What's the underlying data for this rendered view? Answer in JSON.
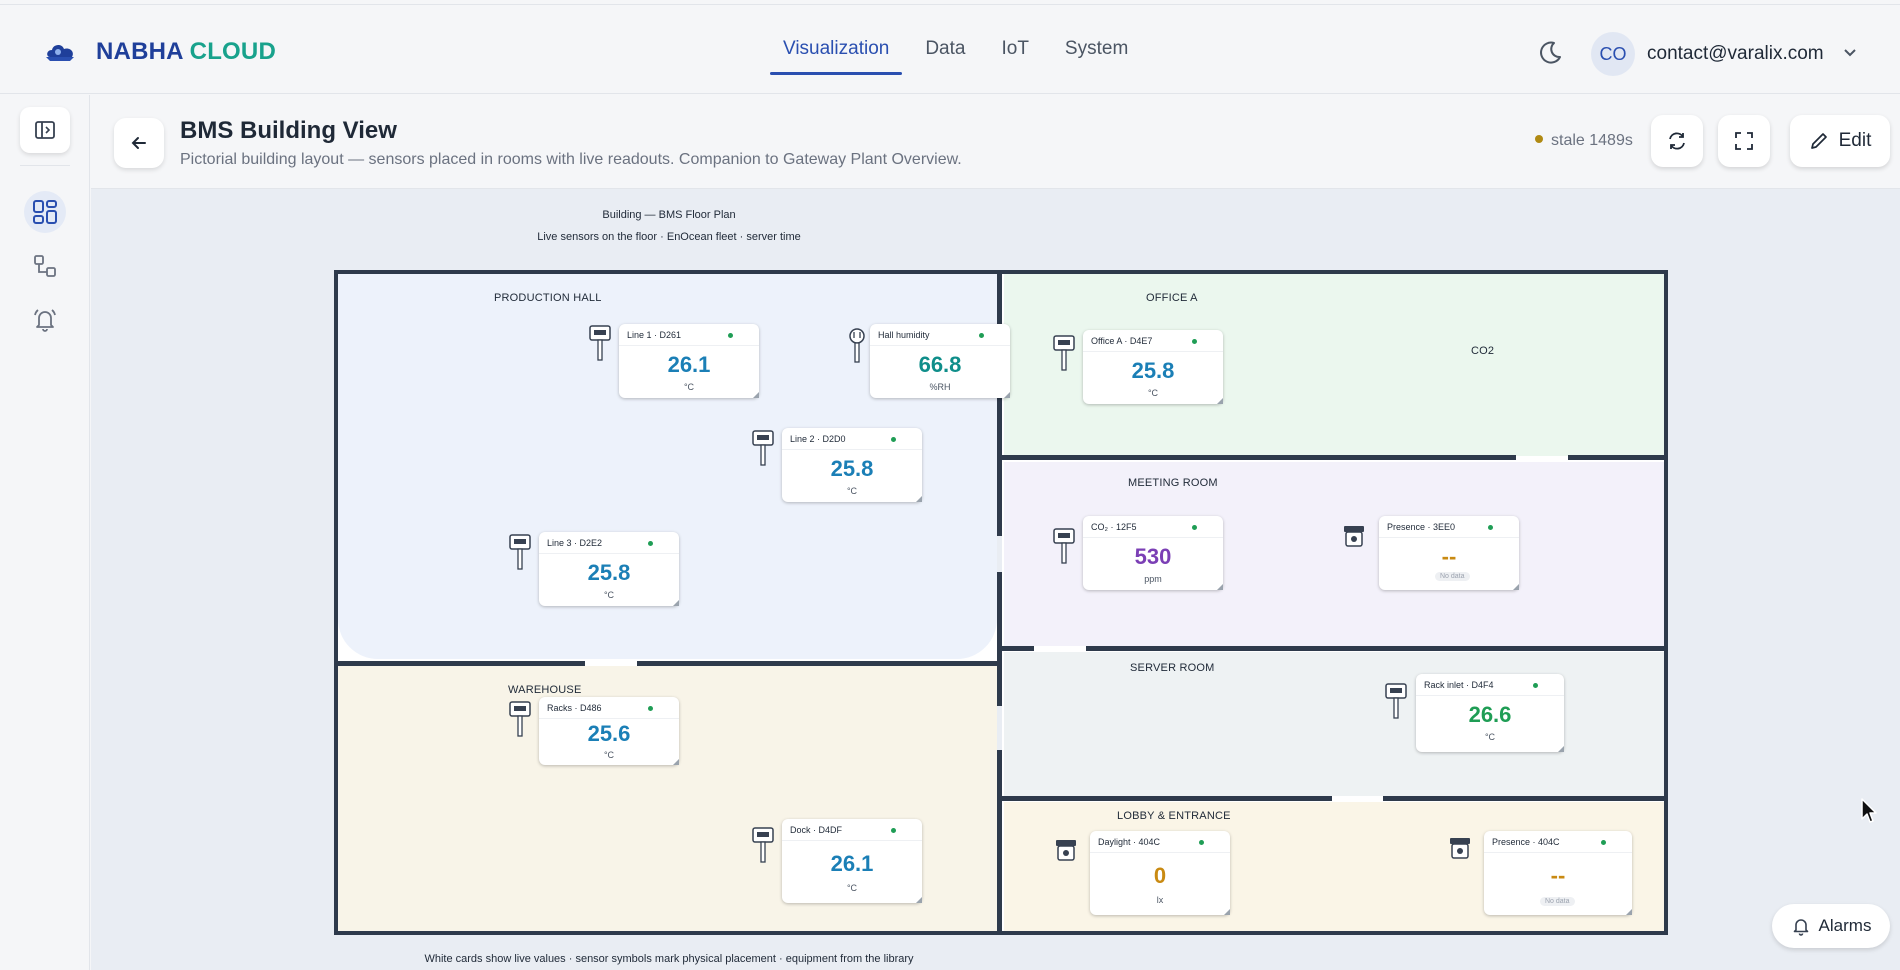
{
  "app": {
    "brand_part1": "NABHA",
    "brand_part2": "CLOUD",
    "user_initials": "CO",
    "user_email": "contact@varalix.com",
    "brand_color": "#1f3f9a",
    "accent_color": "#18a28c"
  },
  "nav": {
    "items": [
      {
        "label": "Visualization",
        "active": true
      },
      {
        "label": "Data",
        "active": false
      },
      {
        "label": "IoT",
        "active": false
      },
      {
        "label": "System",
        "active": false
      }
    ]
  },
  "sidebar": {
    "icons": [
      "sidebar-toggle-icon",
      "dashboard-grid-icon",
      "workflow-icon",
      "alarm-bell-icon"
    ]
  },
  "page": {
    "title": "BMS Building View",
    "subtitle": "Pictorial building layout — sensors placed in rooms with live readouts. Companion to Gateway Plant Overview.",
    "stale": "stale 1489s",
    "edit_label": "Edit",
    "alarms_label": "Alarms"
  },
  "plan": {
    "title": "Building — BMS Floor Plan",
    "subtitle": "Live sensors on the floor · EnOcean fleet · server time",
    "footer": "White cards show live values · sensor symbols mark physical placement · equipment from the library",
    "rooms": {
      "production": "PRODUCTION HALL",
      "warehouse": "WAREHOUSE",
      "office_a": "OFFICE A",
      "office_a_co2": "CO2",
      "meeting": "MEETING ROOM",
      "server": "SERVER ROOM",
      "lobby": "LOBBY & ENTRANCE"
    },
    "cards": {
      "line1": {
        "name": "Line 1 · D261",
        "value": "26.1",
        "unit": "°C"
      },
      "hall_humidity": {
        "name": "Hall humidity",
        "value": "66.8",
        "unit": "%RH"
      },
      "line2": {
        "name": "Line 2 · D2D0",
        "value": "25.8",
        "unit": "°C"
      },
      "line3": {
        "name": "Line 3 · D2E2",
        "value": "25.8",
        "unit": "°C"
      },
      "office_a": {
        "name": "Office A · D4E7",
        "value": "25.8",
        "unit": "°C"
      },
      "co2": {
        "name": "CO₂ · 12F5",
        "value": "530",
        "unit": "ppm"
      },
      "presence_3ee0": {
        "name": "Presence · 3EE0",
        "value": "--",
        "unit": "No data"
      },
      "rack_inlet": {
        "name": "Rack inlet · D4F4",
        "value": "26.6",
        "unit": "°C"
      },
      "racks": {
        "name": "Racks · D486",
        "value": "25.6",
        "unit": "°C"
      },
      "dock": {
        "name": "Dock · D4DF",
        "value": "26.1",
        "unit": "°C"
      },
      "daylight": {
        "name": "Daylight · 404C",
        "value": "0",
        "unit": "lx"
      },
      "presence_404c": {
        "name": "Presence · 404C",
        "value": "--",
        "unit": "No data"
      }
    },
    "colors": {
      "temp": "#1b7fb6",
      "humidity": "#0f8e8a",
      "co2": "#7b3fb5",
      "server": "#1f9d55",
      "amber": "#c98a12",
      "wall": "#2e3a4b"
    }
  }
}
